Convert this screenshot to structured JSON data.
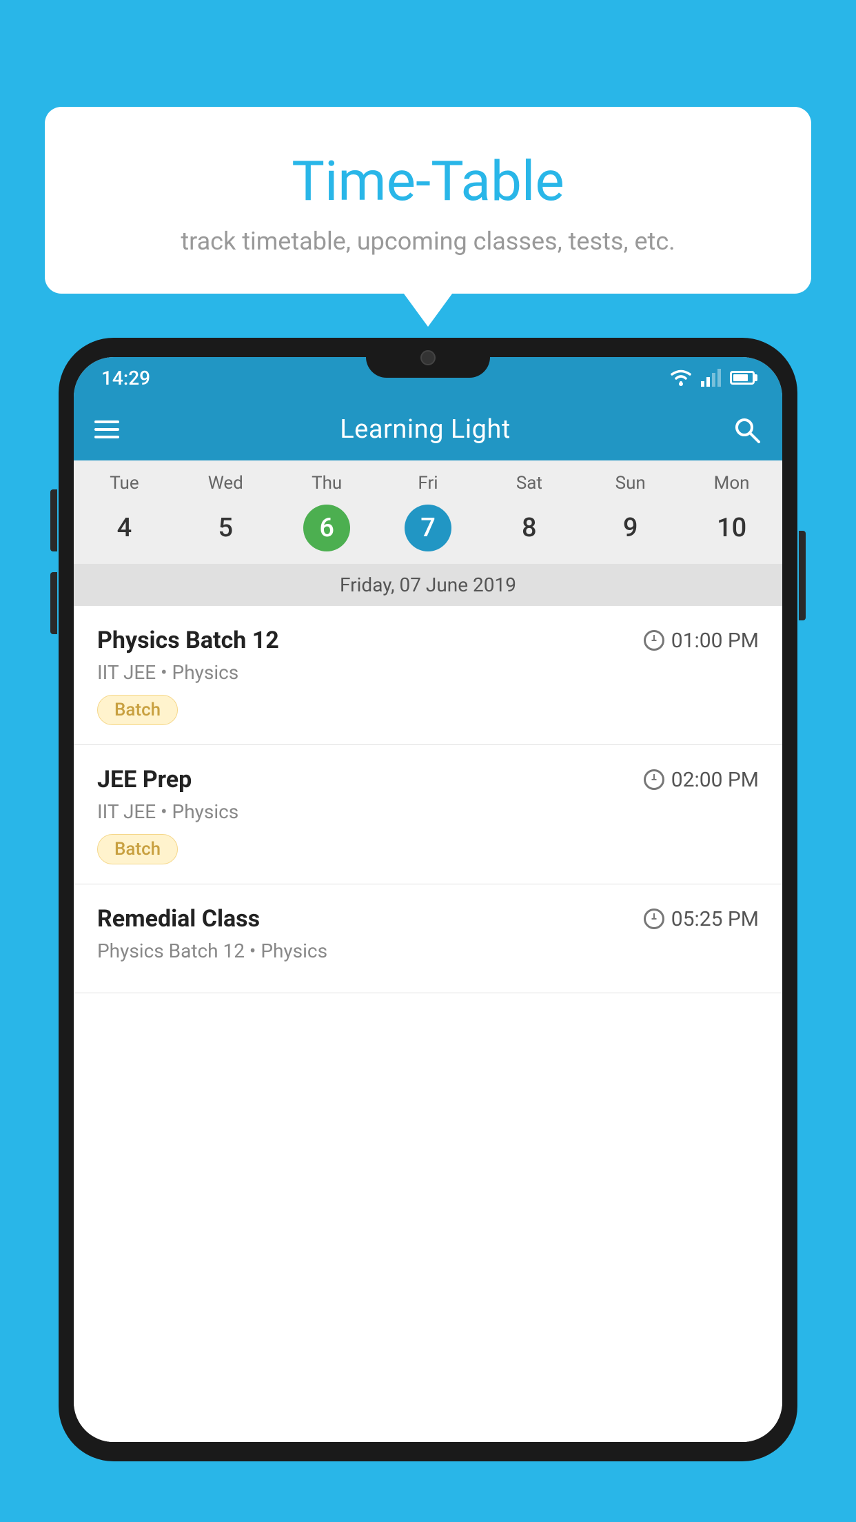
{
  "background_color": "#29b6e8",
  "speech_bubble": {
    "title": "Time-Table",
    "subtitle": "track timetable, upcoming classes, tests, etc."
  },
  "phone": {
    "status_bar": {
      "time": "14:29"
    },
    "app_bar": {
      "title": "Learning Light"
    },
    "calendar": {
      "days": [
        "Tue",
        "Wed",
        "Thu",
        "Fri",
        "Sat",
        "Sun",
        "Mon"
      ],
      "dates": [
        "4",
        "5",
        "6",
        "7",
        "8",
        "9",
        "10"
      ],
      "today_index": 2,
      "selected_index": 3,
      "selected_label": "Friday, 07 June 2019"
    },
    "schedule": [
      {
        "title": "Physics Batch 12",
        "time": "01:00 PM",
        "subtitle": "IIT JEE • Physics",
        "tag": "Batch"
      },
      {
        "title": "JEE Prep",
        "time": "02:00 PM",
        "subtitle": "IIT JEE • Physics",
        "tag": "Batch"
      },
      {
        "title": "Remedial Class",
        "time": "05:25 PM",
        "subtitle": "Physics Batch 12 • Physics",
        "tag": ""
      }
    ]
  }
}
